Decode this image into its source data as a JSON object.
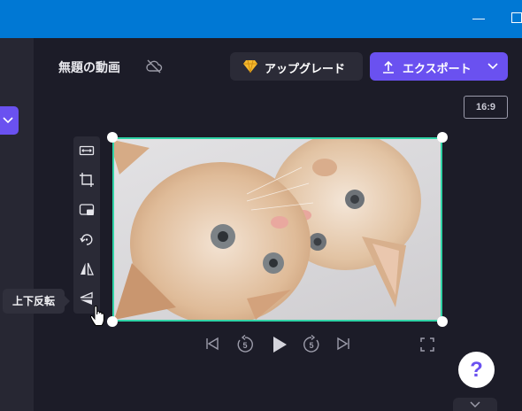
{
  "window": {
    "min_icon": "minimize-icon",
    "max_icon": "maximize-icon"
  },
  "sidebar": {
    "button_icon": "chevron-down-icon"
  },
  "header": {
    "project_title": "無題の動画",
    "cloud_icon": "cloud-off-icon",
    "upgrade_label": "アップグレード",
    "upgrade_icon": "diamond-icon",
    "export_label": "エクスポート",
    "export_icon": "upload-icon"
  },
  "canvas": {
    "aspect_ratio": "16:9",
    "selection_color": "#2fd3a6"
  },
  "tools": [
    {
      "name": "fit-icon"
    },
    {
      "name": "crop-icon"
    },
    {
      "name": "pip-icon"
    },
    {
      "name": "rotate-icon"
    },
    {
      "name": "flip-horizontal-icon"
    },
    {
      "name": "flip-vertical-icon"
    }
  ],
  "tooltip": {
    "text": "上下反転"
  },
  "playback": {
    "icons": [
      "skip-back-icon",
      "rewind-5-icon",
      "play-icon",
      "forward-5-icon",
      "skip-forward-icon",
      "fullscreen-icon"
    ],
    "skip_seconds": "5"
  },
  "help": {
    "label": "?"
  },
  "colors": {
    "accent": "#6a51f0",
    "titlebar": "#0078d4",
    "background": "#1c1c28"
  }
}
